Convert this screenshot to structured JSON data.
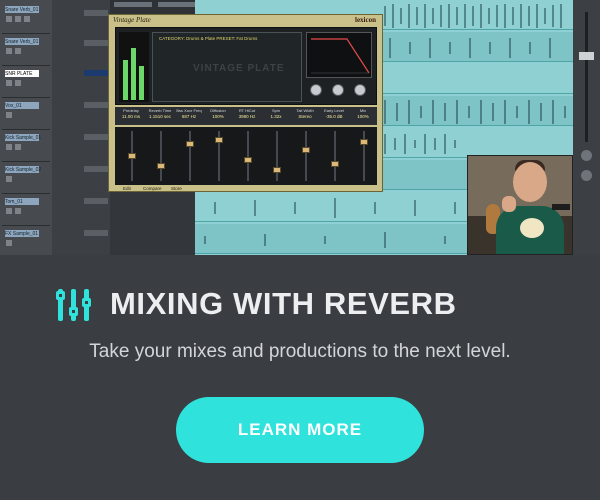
{
  "screenshot": {
    "tracks": [
      {
        "label": "Snare Verb_01",
        "selected": false
      },
      {
        "label": "Snare Verb_01",
        "selected": false
      },
      {
        "label": "SNR PLATE",
        "selected": true
      },
      {
        "label": "Vox_01",
        "selected": false
      },
      {
        "label": "Kick Sample_01",
        "selected": false
      },
      {
        "label": "Kick Sample_02",
        "selected": false
      },
      {
        "label": "Tom_01",
        "selected": false
      },
      {
        "label": "FX Sample_01",
        "selected": false
      }
    ],
    "plugin": {
      "title": "Vintage Plate",
      "brand": "lexicon",
      "screen_line": "CATEGORY: Drums & Plate    PRESET: Fat Drums",
      "display_name": "VINTAGE PLATE",
      "params": [
        {
          "label": "Predelay",
          "value": "11.00 ms"
        },
        {
          "label": "Reverb Time",
          "value": "1.1510 sec"
        },
        {
          "label": "Bss Xovr Freq",
          "value": "687 Hz"
        },
        {
          "label": "Diffusion",
          "value": "100%"
        },
        {
          "label": "RT HiCut",
          "value": "3980 Hz"
        },
        {
          "label": "Spin",
          "value": "1.32x"
        },
        {
          "label": "Tail Width",
          "value": "Stereo"
        },
        {
          "label": "Early Level",
          "value": "-35.0 dB"
        },
        {
          "label": "Mix",
          "value": "100%"
        }
      ],
      "footer": [
        "Edit",
        "Compare",
        "Store"
      ]
    }
  },
  "promo": {
    "icon": "sliders-icon",
    "title": "MIXING WITH REVERB",
    "subtitle": "Take your mixes and productions to the next level.",
    "cta_label": "LEARN MORE",
    "accent_color": "#2fe3dc",
    "background_color": "#3a3d41"
  }
}
